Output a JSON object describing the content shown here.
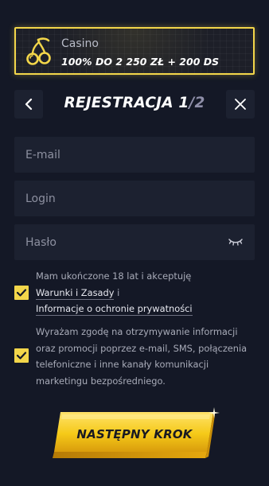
{
  "promo": {
    "icon": "cherries-icon",
    "category": "Casino",
    "offer": "100% DO 2 250 ZŁ + 200 DS"
  },
  "header": {
    "back_icon": "chevron-left-icon",
    "title": "REJESTRACJA",
    "step_current": "1",
    "step_separator": "/",
    "step_total": "2",
    "close_icon": "close-icon"
  },
  "form": {
    "email_placeholder": "E-mail",
    "login_placeholder": "Login",
    "password_placeholder": "Hasło",
    "password_toggle_icon": "eye-closed-icon"
  },
  "consents": {
    "terms": {
      "checked": true,
      "text_before": "Mam ukończone 18 lat i akceptuję",
      "terms_link": "Warunki i Zasady",
      "conjunction": " i",
      "privacy_link": "Informacje o ochronie prywatności"
    },
    "marketing": {
      "checked": true,
      "lines": [
        "Wyrażam zgodę na otrzymywanie informacji",
        "oraz promocji poprzez e-mail, SMS, połączenia",
        "telefoniczne i inne kanały komunikacji",
        "marketingu bezpośredniego."
      ]
    }
  },
  "next_button": {
    "label": "NASTĘPNY KROK"
  },
  "colors": {
    "background": "#141826",
    "field": "#1c2130",
    "accent": "#f3d64a",
    "button_gold": "#f5c918",
    "text_muted": "#a8abb8"
  }
}
